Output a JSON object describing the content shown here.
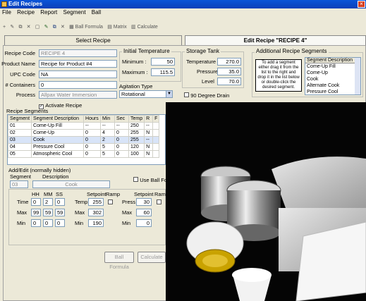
{
  "window": {
    "title": "Edit Recipes",
    "close": "×"
  },
  "menu": [
    "File",
    "Recipe",
    "Report",
    "Segment",
    "Ball"
  ],
  "toolbar": {
    "ball_formula": "Ball Formula",
    "matrix": "Matrix",
    "calculate": "Calculate"
  },
  "tabs": {
    "select": "Select Recipe",
    "edit": "Edit Recipe \"RECIPE 4\""
  },
  "recipe": {
    "code_label": "Recipe Code",
    "code": "RECIPE 4",
    "product_label": "Product Name",
    "product": "Recipe for Product #4",
    "upc_label": "UPC Code",
    "upc": "NA",
    "containers_label": "# Containers",
    "containers": "0",
    "process_label": "Process",
    "process": "Allpax Water Immersion",
    "activate_label": "Activate Recipe"
  },
  "initial_temp": {
    "title": "Initial Temperature",
    "min_label": "Minimum :",
    "min": "50",
    "max_label": "Maximum :",
    "max": "115.5"
  },
  "agitation": {
    "title": "Agitation Type",
    "value": "Rotational"
  },
  "storage": {
    "title": "Storage Tank",
    "temp_label": "Temperature",
    "temp": "270.0",
    "pressure_label": "Pressure",
    "pressure": "35.0",
    "level_label": "Level",
    "level": "70.0",
    "drain_label": "90 Degree Drain"
  },
  "additional": {
    "title": "Additional Recipe Segments",
    "help": "To add a segment either drag it from the list to the right and drop it in the list below or double-click the desired segment.",
    "header": "Segment Description",
    "items": [
      "Come-Up Fill",
      "Come-Up",
      "Cook",
      "Alternate Cook",
      "Pressure Cool"
    ]
  },
  "segments": {
    "title": "Recipe Segments",
    "headers": [
      "Segment",
      "Segment Description",
      "Hours",
      "Min",
      "Sec",
      "Temp",
      "R",
      "F"
    ],
    "rows": [
      [
        "01",
        "Come-Up Fill",
        "--",
        "--",
        "--",
        "250",
        "--",
        ""
      ],
      [
        "02",
        "Come-Up",
        "0",
        "4",
        "0",
        "255",
        "N",
        ""
      ],
      [
        "03",
        "Cook",
        "0",
        "2",
        "0",
        "255",
        "--",
        ""
      ],
      [
        "04",
        "Pressure Cool",
        "0",
        "5",
        "0",
        "120",
        "N",
        ""
      ],
      [
        "05",
        "Atmospheric Cool",
        "0",
        "5",
        "0",
        "100",
        "N",
        ""
      ]
    ]
  },
  "addedit": {
    "title": "Add/Edit (normally hidden)",
    "segment_label": "Segment",
    "desc_label": "Description",
    "segment": "03",
    "desc": "Cook",
    "use_ball_label": "Use Ball For",
    "hh": "HH",
    "mm": "MM",
    "ss": "SS",
    "time_label": "Time",
    "max_label": "Max",
    "min_label": "Min",
    "time": [
      "0",
      "2",
      "0"
    ],
    "max": [
      "99",
      "59",
      "59"
    ],
    "min": [
      "0",
      "0",
      "0"
    ],
    "setpoint": "Setpoint",
    "ramp": "Ramp",
    "temp_label": "Temp",
    "temp": "255",
    "temp_max": "302",
    "temp_min": "190",
    "press_label": "Press",
    "press": "30",
    "press_max": "60",
    "press_min": "0",
    "ball_btn": "Ball Formula",
    "calc_btn": "Calculate"
  }
}
